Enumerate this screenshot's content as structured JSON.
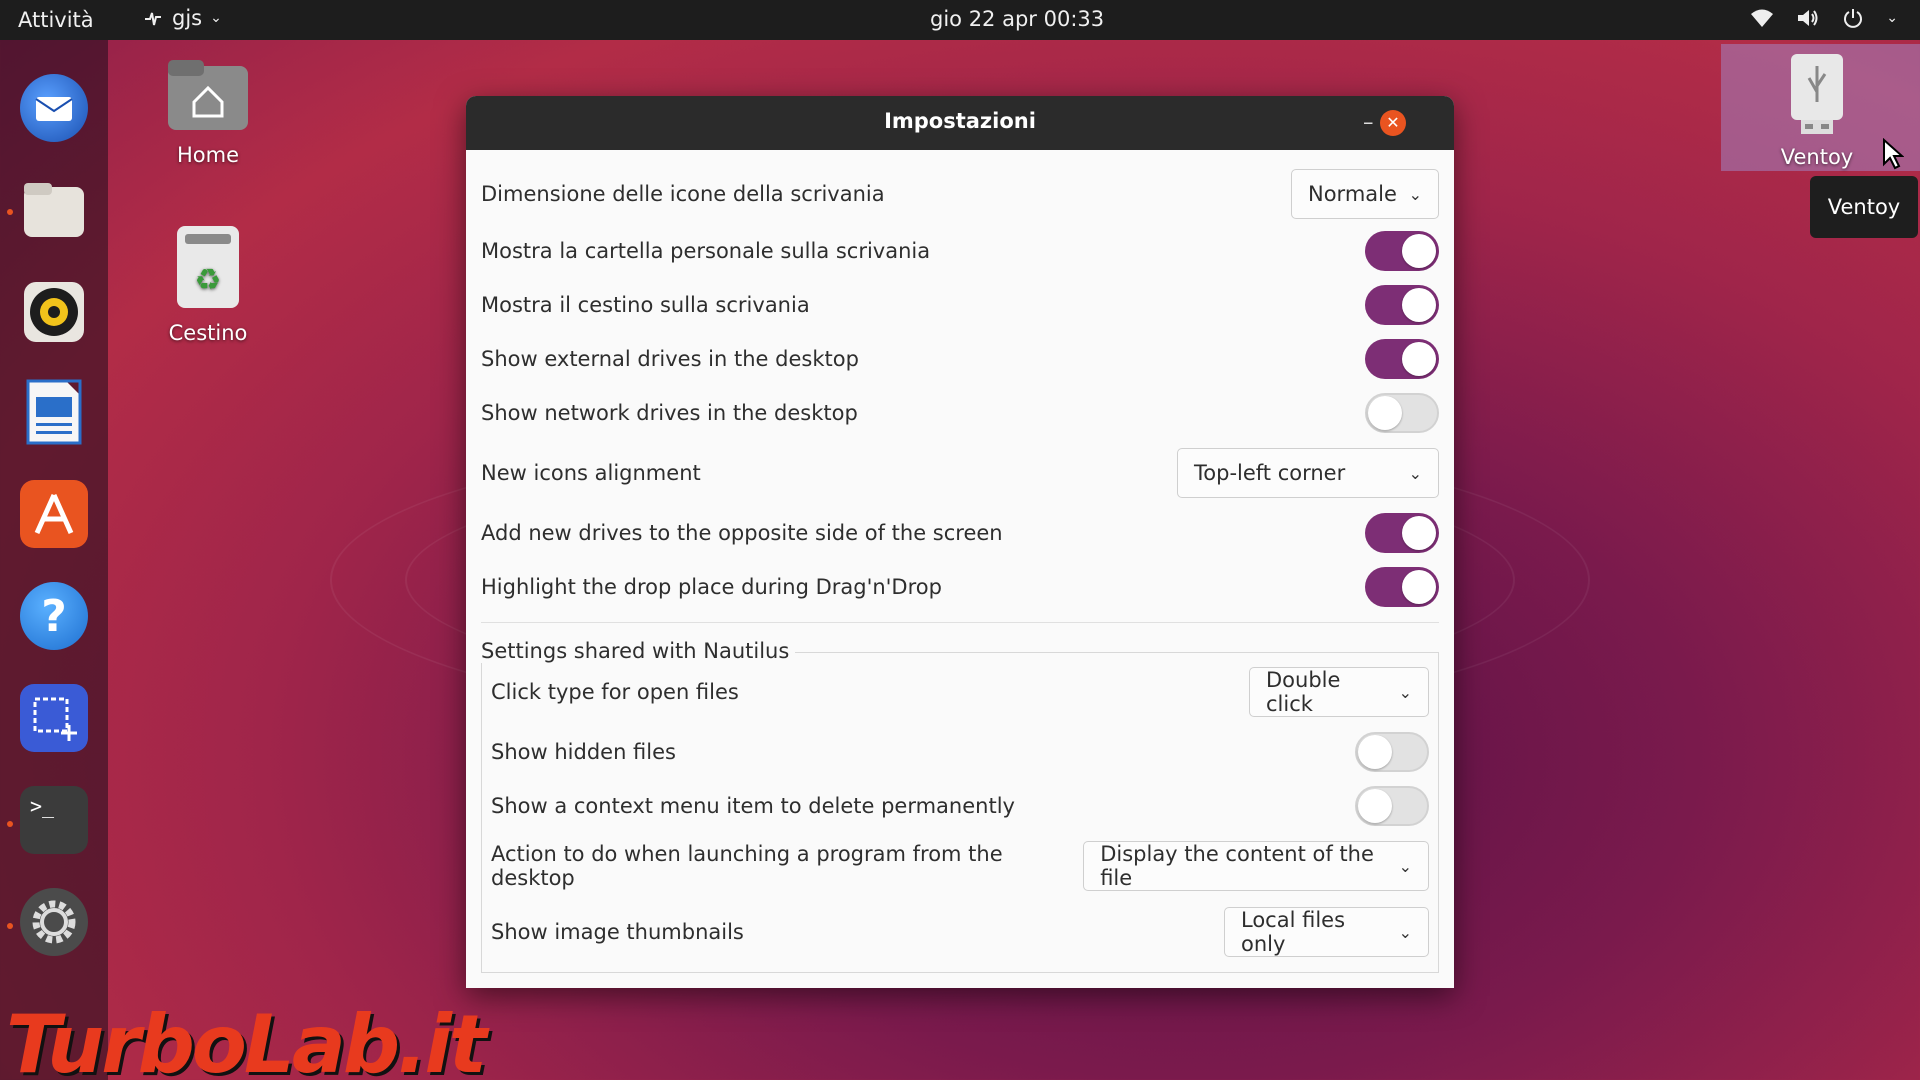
{
  "topbar": {
    "activities": "Attività",
    "app_name": "gjs",
    "clock": "gio 22 apr  00:33"
  },
  "desktop": {
    "home_label": "Home",
    "trash_label": "Cestino",
    "ventoy_label": "Ventoy",
    "tooltip": "Ventoy"
  },
  "window": {
    "title": "Impostazioni",
    "rows": [
      {
        "label": "Dimensione delle icone della scrivania",
        "value": "Normale"
      },
      {
        "label": "Mostra la cartella personale sulla scrivania",
        "on": true
      },
      {
        "label": "Mostra il cestino sulla scrivania",
        "on": true
      },
      {
        "label": "Show external drives in the desktop",
        "on": true
      },
      {
        "label": "Show network drives in the desktop",
        "on": false
      },
      {
        "label": "New icons alignment",
        "value": "Top-left corner"
      },
      {
        "label": "Add new drives to the opposite side of the screen",
        "on": true
      },
      {
        "label": "Highlight the drop place during Drag'n'Drop",
        "on": true
      }
    ],
    "nautilus": {
      "section_title": "Settings shared with Nautilus",
      "rows": [
        {
          "label": "Click type for open files",
          "value": "Double click"
        },
        {
          "label": "Show hidden files",
          "on": false
        },
        {
          "label": "Show a context menu item to delete permanently",
          "on": false
        },
        {
          "label": "Action to do when launching a program from the desktop",
          "value": "Display the content of the file"
        },
        {
          "label": "Show image thumbnails",
          "value": "Local files only"
        }
      ]
    }
  },
  "watermark": "TurboLab.it",
  "colors": {
    "accent": "#7d2e75",
    "close": "#e95420",
    "topbar": "#1d1d1d"
  }
}
